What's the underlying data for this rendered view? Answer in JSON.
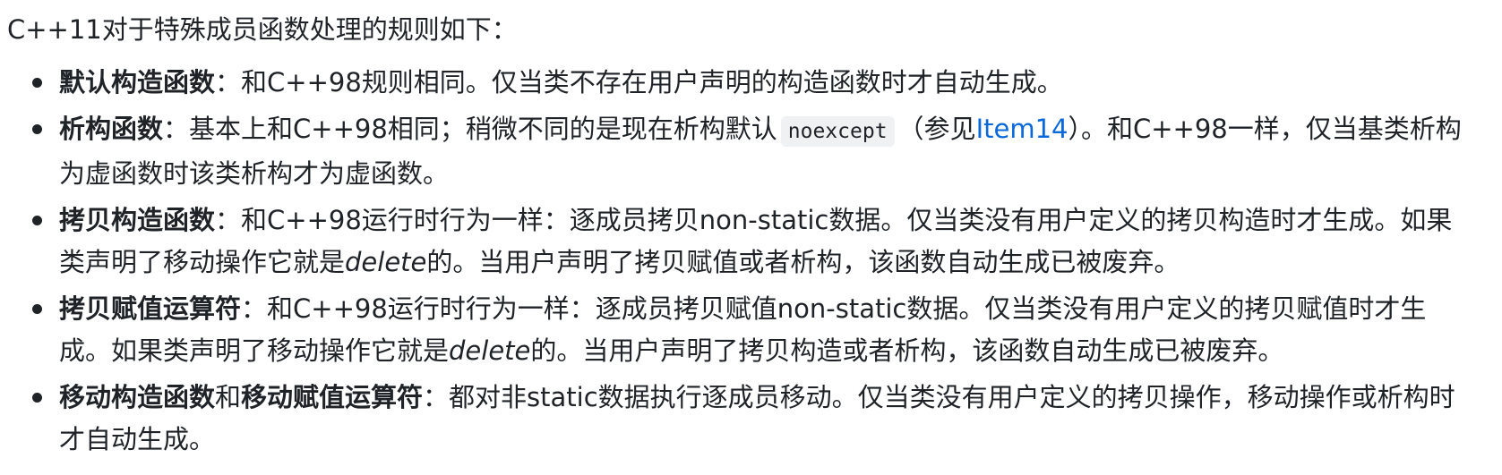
{
  "intro": "C++11对于特殊成员函数处理的规则如下：",
  "rules": [
    {
      "term": "默认构造函数",
      "text": "：和C++98规则相同。仅当类不存在用户声明的构造函数时才自动生成。"
    },
    {
      "term": "析构函数",
      "text_a": "：基本上和C++98相同；稍微不同的是现在析构默认",
      "code": "noexcept",
      "text_b": "（参见",
      "link": "Item14",
      "text_c": "）。和C++98一样，仅当基类析构为虚函数时该类析构才为虚函数。"
    },
    {
      "term": "拷贝构造函数",
      "text_a": "：和C++98运行时行为一样：逐成员拷贝non-static数据。仅当类没有用户定义的拷贝构造时才生成。如果类声明了移动操作它就是",
      "em": "delete",
      "text_b": "的。当用户声明了拷贝赋值或者析构，该函数自动生成已被废弃。"
    },
    {
      "term": "拷贝赋值运算符",
      "text_a": "：和C++98运行时行为一样：逐成员拷贝赋值non-static数据。仅当类没有用户定义的拷贝赋值时才生成。如果类声明了移动操作它就是",
      "em": "delete",
      "text_b": "的。当用户声明了拷贝构造或者析构，该函数自动生成已被废弃。"
    },
    {
      "term_a": "移动构造函数",
      "joiner": "和",
      "term_b": "移动赋值运算符",
      "text": "：都对非static数据执行逐成员移动。仅当类没有用户定义的拷贝操作，移动操作或析构时才自动生成。"
    }
  ]
}
